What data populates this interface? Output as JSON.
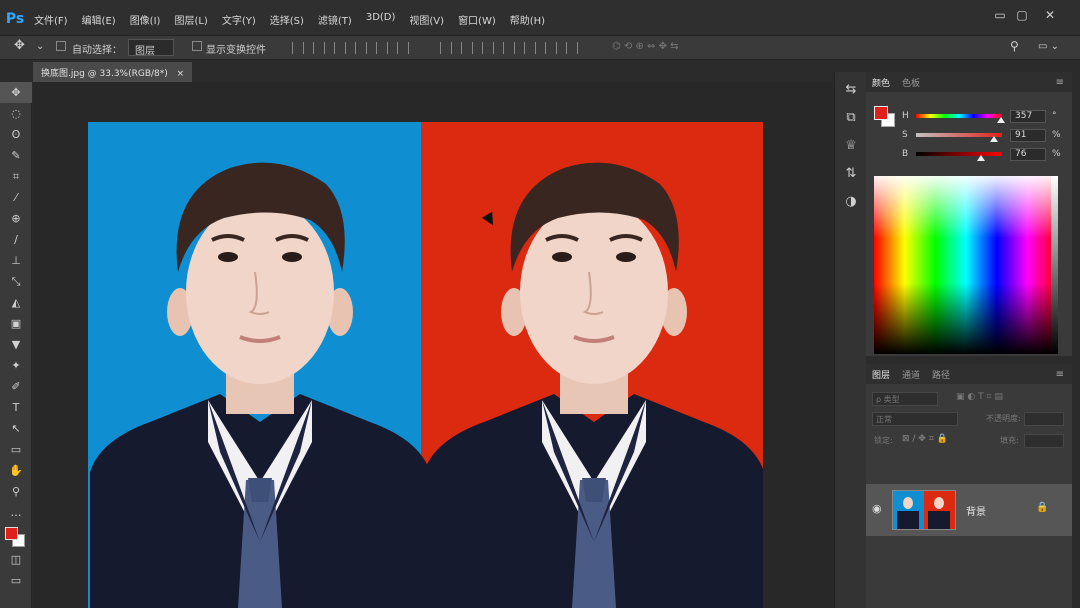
{
  "app": {
    "logo": "Ps"
  },
  "menu": [
    "文件(F)",
    "编辑(E)",
    "图像(I)",
    "图层(L)",
    "文字(Y)",
    "选择(S)",
    "滤镜(T)",
    "3D(D)",
    "视图(V)",
    "窗口(W)",
    "帮助(H)"
  ],
  "window_controls": {
    "minimize": "▭",
    "restore": "▢",
    "close": "✕"
  },
  "options": {
    "auto_select_label": "自动选择：",
    "auto_select_value": "图层",
    "transform_label": "显示变换控件"
  },
  "document": {
    "tab_title": "换底图.jpg @ 33.3%(RGB/8*)",
    "close_glyph": "×"
  },
  "tools": [
    "✥",
    "◌",
    "ʘ",
    "✎",
    "⌗",
    "⁄",
    "⊕",
    "∕",
    "⊥",
    "⤡",
    "◭",
    "▣",
    "▼",
    "✦",
    "✐",
    "T",
    "↖",
    "▭",
    "✋",
    "⚲",
    "…"
  ],
  "strip_icons": [
    "⇆",
    "⧉",
    "♕",
    "⇅",
    "◑"
  ],
  "color_panel": {
    "tabs": [
      "颜色",
      "色板"
    ],
    "active_tab": "颜色",
    "fg_color": "#e0201a",
    "bg_color": "#ffffff",
    "h": {
      "label": "H",
      "value": "357",
      "unit": "°",
      "level": 0.99
    },
    "s": {
      "label": "S",
      "value": "91",
      "unit": "%",
      "level": 0.91
    },
    "b": {
      "label": "B",
      "value": "76",
      "unit": "%",
      "level": 0.76
    }
  },
  "layers_panel": {
    "tabs": [
      "图层",
      "通道",
      "路径"
    ],
    "active_tab": "图层",
    "search_placeholder": "ρ 类型",
    "blend_mode": "正常",
    "opacity_label": "不透明度:",
    "lock_label": "锁定:",
    "fill_label": "填充:",
    "layer_name": "背景"
  },
  "colors": {
    "blue_bg": "#0f8ed1",
    "red_bg": "#dc2a10",
    "accent": "#31a8ff"
  }
}
